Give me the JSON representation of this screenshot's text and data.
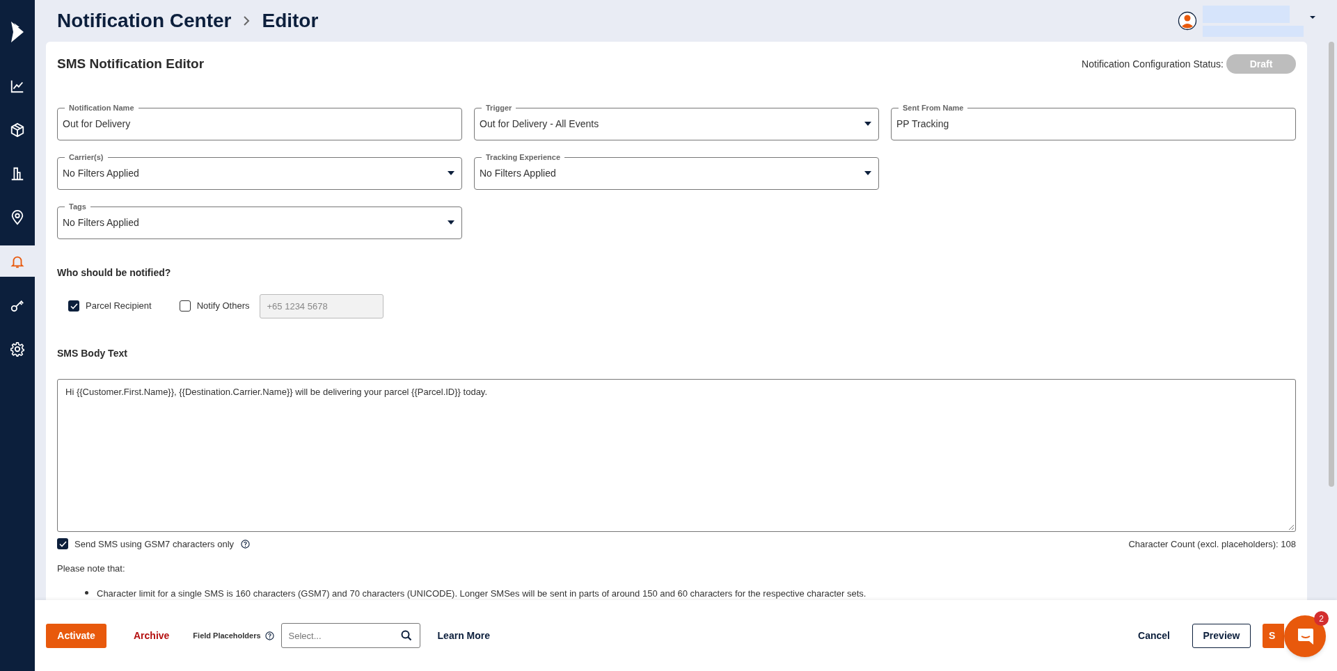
{
  "sidebar": {
    "items": [
      {
        "kind": "chart",
        "selected": false
      },
      {
        "kind": "box",
        "selected": false
      },
      {
        "kind": "building",
        "selected": false
      },
      {
        "kind": "pin",
        "selected": false
      },
      {
        "kind": "bell",
        "selected": true
      },
      {
        "kind": "key",
        "selected": false
      },
      {
        "kind": "gear",
        "selected": false
      }
    ]
  },
  "breadcrumb": [
    {
      "label": "Notification Center"
    },
    {
      "label": "Editor"
    }
  ],
  "editor": {
    "title": "SMS Notification Editor",
    "status_label": "Notification Configuration Status:",
    "status": "Draft"
  },
  "field_rows": [
    [
      {
        "label": "Notification Name",
        "value": "Out for Delivery",
        "kind": "text"
      },
      {
        "label": "Trigger",
        "value": "Out for Delivery - All Events",
        "kind": "select"
      },
      {
        "label": "Sent From Name",
        "value": "PP Tracking",
        "kind": "text"
      }
    ],
    [
      {
        "label": "Carrier(s)",
        "value": "No Filters Applied",
        "kind": "select"
      },
      {
        "label": "Tracking Experience",
        "value": "No Filters Applied",
        "kind": "select"
      }
    ],
    [
      {
        "label": "Tags",
        "value": "No Filters Applied",
        "kind": "select"
      }
    ]
  ],
  "recipients": {
    "heading": "Who should be notified?",
    "options": [
      {
        "label": "Parcel Recipient",
        "checked": true
      },
      {
        "label": "Notify Others",
        "checked": false
      }
    ],
    "phone": {
      "placeholder": "+65 1234 5678",
      "disabled": true
    }
  },
  "body": {
    "heading": "SMS Body Text",
    "text": "Hi {{Customer.First.Name}}, {{Destination.Carrier.Name}} will be delivering your parcel {{Parcel.ID}} today."
  },
  "gsm7": {
    "label": "Send SMS using GSM7 characters only",
    "checked": true
  },
  "character_count": "Character Count (excl. placeholders): 108",
  "note": {
    "intro": "Please note that:",
    "bullets": [
      "Character limit for a single SMS is 160 characters (GSM7) and 70 characters (UNICODE). Longer SMSes will be sent in parts of around 150 and 60 characters for the respective character sets."
    ]
  },
  "footer": {
    "activate": "Activate",
    "archive": "Archive",
    "placeholders": {
      "label": "Field Placeholders",
      "placeholder": "Select..."
    },
    "learn_more": "Learn More",
    "cancel": "Cancel",
    "preview": "Preview",
    "save": "S"
  },
  "chat": {
    "badge": "2"
  }
}
